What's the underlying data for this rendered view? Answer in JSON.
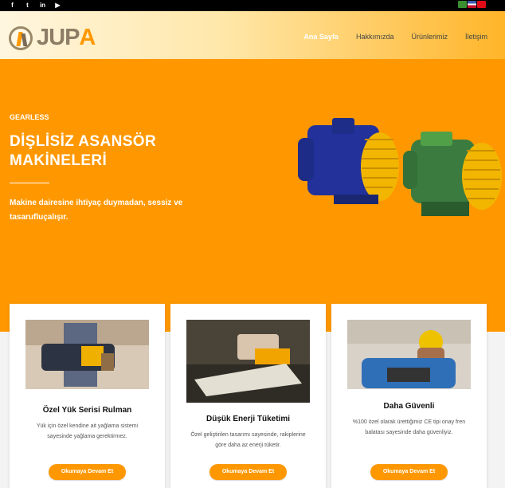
{
  "topbar": {
    "social_icons": [
      "facebook-icon",
      "twitter-icon",
      "linkedin-icon",
      "youtube-icon"
    ],
    "flag_colors": [
      "#3a8f31",
      "#3c5cad",
      "#e30a17"
    ]
  },
  "header": {
    "logo_prefix": "JUP",
    "logo_suffix": "A",
    "nav": [
      {
        "label": "Ana Sayfa",
        "active": true
      },
      {
        "label": "Hakkımızda",
        "active": false
      },
      {
        "label": "Ürünlerimiz",
        "active": false
      },
      {
        "label": "İletişim",
        "active": false
      }
    ]
  },
  "hero": {
    "kicker": "GEARLESS",
    "title": "DİŞLİSİZ ASANSÖR MAKİNELERİ",
    "subtitle": "Makine dairesine ihtiyaç duymadan, sessiz ve tasarufluçalışır."
  },
  "cards": [
    {
      "title": "Özel Yük Serisi Rulman",
      "text": "Yük için özel kendine ait yağlama sistemi sayesinde yağlama gerektirmez.",
      "button": "Okumaya Devam Et"
    },
    {
      "title": "Düşük Enerji Tüketimi",
      "text": "Özel geliştirilen tasarımı sayesinde, rakiplerine göre daha az enerji tüketir.",
      "button": "Okumaya Devam Et"
    },
    {
      "title": "Daha Güvenli",
      "text": "%100 özel olarak ürettiğimiz CE tipi onay fren balatası sayesinde daha güvenliyiz.",
      "button": "Okumaya Devam Et"
    }
  ],
  "colors": {
    "accent": "#ff9800",
    "topbar": "#000000"
  }
}
